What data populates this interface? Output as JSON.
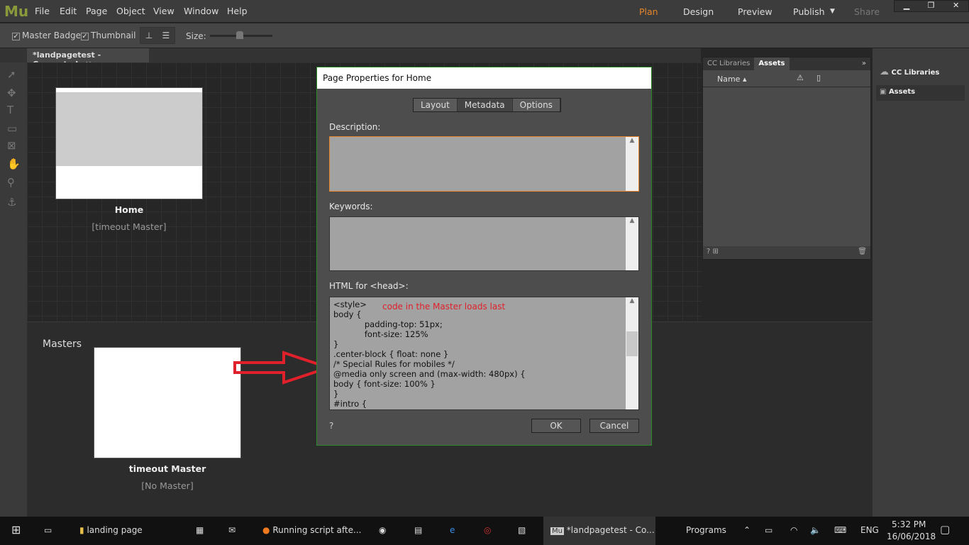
{
  "app": {
    "logo": "Mu",
    "menu": [
      "File",
      "Edit",
      "Page",
      "Object",
      "View",
      "Window",
      "Help"
    ],
    "modes": {
      "plan": "Plan",
      "design": "Design",
      "preview": "Preview",
      "publish": "Publish",
      "share": "Share"
    },
    "accent": "#e8862a"
  },
  "toolbar": {
    "master_badge": "Master Badge",
    "thumbnail": "Thumbnail",
    "size": "Size:",
    "size_value": 0.45
  },
  "document_tab": "*landpagetest - Converted",
  "pages": [
    {
      "name": "Home",
      "master": "[timeout Master]"
    }
  ],
  "masters": {
    "heading": "Masters",
    "items": [
      {
        "name": "timeout Master",
        "master": "[No Master]"
      }
    ]
  },
  "assets_panel": {
    "tabs": [
      "CC Libraries",
      "Assets"
    ],
    "column": "Name"
  },
  "right_panel": {
    "items": [
      "CC Libraries",
      "Assets"
    ]
  },
  "dialog": {
    "title": "Page Properties for Home",
    "tabs": [
      "Layout",
      "Metadata",
      "Options"
    ],
    "active_tab": "Metadata",
    "description_label": "Description:",
    "description": "",
    "keywords_label": "Keywords:",
    "keywords": "",
    "head_label": "HTML for <head>:",
    "head_code": "<style>\nbody {\n            padding-top: 51px;\n            font-size: 125%\n}\n.center-block { float: none }\n/* Special Rules for mobiles */\n@media only screen and (max-width: 480px) {\nbody { font-size: 100% }\n}\n#intro {",
    "annotation": "code in the Master loads last",
    "ok": "OK",
    "cancel": "Cancel"
  },
  "taskbar": {
    "items": [
      "landing page",
      "Running script afte...",
      "*landpagetest - Co..."
    ],
    "programs": "Programs",
    "lang": "ENG",
    "time": "5:32 PM",
    "date": "16/06/2018"
  }
}
